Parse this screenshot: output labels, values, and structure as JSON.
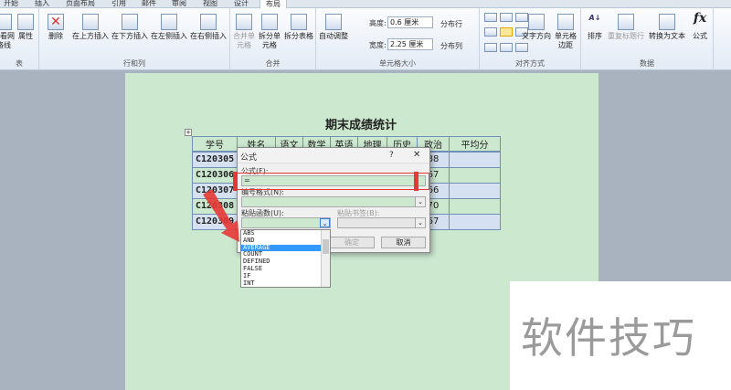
{
  "tabs": [
    "开始",
    "插入",
    "页面布局",
    "引用",
    "邮件",
    "审阅",
    "视图",
    "设计",
    "布局"
  ],
  "ribbon": {
    "groups": {
      "table": "表",
      "rows_cols": "行和列",
      "merge": "合并",
      "cell_size": "单元格大小",
      "alignment": "对齐方式",
      "data": "数据"
    },
    "buttons": {
      "view_gridlines": "查看网格线",
      "properties": "属性",
      "delete": "删除",
      "insert_above": "在上方插入",
      "insert_below": "在下方插入",
      "insert_left": "在左侧插入",
      "insert_right": "在右侧插入",
      "merge_cells": "合并单元格",
      "split_cells": "拆分单元格",
      "split_table": "拆分表格",
      "autofit": "自动调整",
      "distribute_rows": "分布行",
      "distribute_cols": "分布列",
      "text_direction": "文字方向",
      "cell_margins": "单元格边距",
      "sort": "排序",
      "repeat_header": "重复标题行",
      "convert_to_text": "转换为文本",
      "formula": "公式"
    },
    "height_label": "高度:",
    "height_value": "0.6 厘米",
    "width_label": "宽度:",
    "width_value": "2.25 厘米"
  },
  "document": {
    "title": "期末成绩统计",
    "headers": [
      "学号",
      "姓名",
      "语文",
      "数学",
      "英语",
      "地理",
      "历史",
      "政治",
      "平均分"
    ],
    "rows": [
      {
        "id": "C120305",
        "politics": "88"
      },
      {
        "id": "C120306",
        "politics": "67"
      },
      {
        "id": "C120307",
        "politics": "66"
      },
      {
        "id": "C120308",
        "politics": "70"
      },
      {
        "id": "C120309",
        "politics": "67"
      }
    ]
  },
  "dialog": {
    "title": "公式",
    "help": "?",
    "close": "✕",
    "formula_label": "公式(F):",
    "formula_value": "=",
    "number_format_label": "编号格式(N):",
    "number_format_value": "",
    "paste_function_label": "粘贴函数(U):",
    "paste_bookmark_label": "粘贴书签(B):",
    "ok": "确定",
    "cancel": "取消",
    "functions": [
      "ABS",
      "AND",
      "AVERAGE",
      "COUNT",
      "DEFINED",
      "FALSE",
      "IF",
      "INT"
    ],
    "selected_function": "AVERAGE"
  },
  "annotation_color": "#e53935",
  "watermark": "软件技巧"
}
